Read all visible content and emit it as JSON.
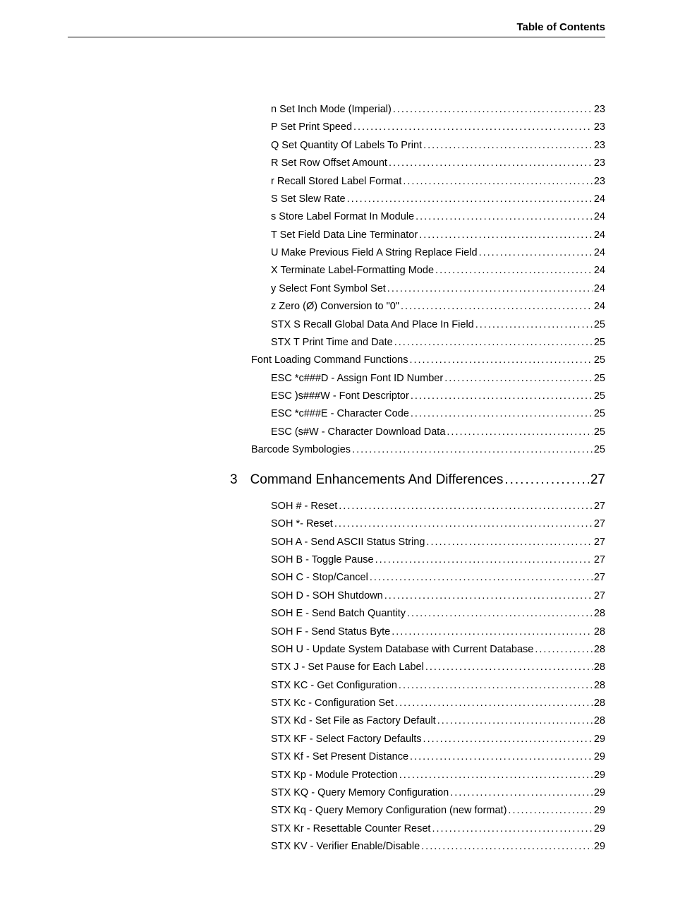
{
  "header": {
    "title": "Table of Contents"
  },
  "section": {
    "number": "3",
    "title": "Command Enhancements And Differences",
    "page": "27"
  },
  "toc_a": [
    {
      "level": 3,
      "label": "n Set Inch Mode (Imperial)",
      "page": "23"
    },
    {
      "level": 3,
      "label": "P Set Print Speed",
      "page": "23"
    },
    {
      "level": 3,
      "label": "Q Set Quantity Of Labels To Print",
      "page": "23"
    },
    {
      "level": 3,
      "label": "R Set Row Offset Amount",
      "page": "23"
    },
    {
      "level": 3,
      "label": "r Recall Stored Label Format",
      "page": "23"
    },
    {
      "level": 3,
      "label": "S Set Slew Rate",
      "page": "24"
    },
    {
      "level": 3,
      "label": "s Store Label Format In Module",
      "page": "24"
    },
    {
      "level": 3,
      "label": "T Set Field Data Line Terminator",
      "page": "24"
    },
    {
      "level": 3,
      "label": "U Make Previous Field A String Replace Field",
      "page": "24"
    },
    {
      "level": 3,
      "label": "X Terminate Label-Formatting Mode",
      "page": "24"
    },
    {
      "level": 3,
      "label": "y Select Font Symbol Set",
      "page": "24"
    },
    {
      "level": 3,
      "label": "z Zero (Ø) Conversion to \"0\"",
      "page": "24"
    },
    {
      "level": 3,
      "label": "STX S Recall Global Data And Place In Field",
      "page": "25"
    },
    {
      "level": 3,
      "label": "STX T Print Time and Date",
      "page": "25"
    },
    {
      "level": 2,
      "label": "Font Loading Command Functions",
      "page": "25"
    },
    {
      "level": 3,
      "label": "ESC *c###D - Assign Font ID Number",
      "page": "25"
    },
    {
      "level": 3,
      "label": "ESC )s###W - Font Descriptor",
      "page": "25"
    },
    {
      "level": 3,
      "label": "ESC *c###E - Character Code",
      "page": "25"
    },
    {
      "level": 3,
      "label": "ESC (s#W - Character Download Data",
      "page": "25"
    },
    {
      "level": 2,
      "label": "Barcode Symbologies",
      "page": "25"
    }
  ],
  "toc_b": [
    {
      "level": 3,
      "label": "SOH # - Reset",
      "page": "27"
    },
    {
      "level": 3,
      "label": "SOH *- Reset",
      "page": "27"
    },
    {
      "level": 3,
      "label": "SOH A - Send ASCII Status String",
      "page": "27"
    },
    {
      "level": 3,
      "label": "SOH B - Toggle Pause",
      "page": "27"
    },
    {
      "level": 3,
      "label": "SOH C - Stop/Cancel",
      "page": "27"
    },
    {
      "level": 3,
      "label": "SOH D - SOH Shutdown",
      "page": "27"
    },
    {
      "level": 3,
      "label": "SOH E - Send Batch Quantity",
      "page": "28"
    },
    {
      "level": 3,
      "label": "SOH F - Send Status Byte",
      "page": "28"
    },
    {
      "level": 3,
      "label": "SOH U - Update System Database with Current Database",
      "page": "28"
    },
    {
      "level": 3,
      "label": "STX J - Set Pause for Each Label",
      "page": "28"
    },
    {
      "level": 3,
      "label": "STX KC - Get Configuration",
      "page": "28"
    },
    {
      "level": 3,
      "label": "STX Kc - Configuration Set",
      "page": "28"
    },
    {
      "level": 3,
      "label": "STX Kd - Set File as Factory Default",
      "page": "28"
    },
    {
      "level": 3,
      "label": "STX KF - Select Factory Defaults",
      "page": "29"
    },
    {
      "level": 3,
      "label": "STX Kf - Set Present Distance",
      "page": "29"
    },
    {
      "level": 3,
      "label": "STX Kp - Module Protection",
      "page": "29"
    },
    {
      "level": 3,
      "label": "STX KQ - Query Memory Configuration",
      "page": "29"
    },
    {
      "level": 3,
      "label": "STX Kq - Query Memory Configuration (new format)",
      "page": "29"
    },
    {
      "level": 3,
      "label": "STX Kr - Resettable Counter Reset",
      "page": "29"
    },
    {
      "level": 3,
      "label": "STX KV - Verifier Enable/Disable",
      "page": "29"
    }
  ]
}
